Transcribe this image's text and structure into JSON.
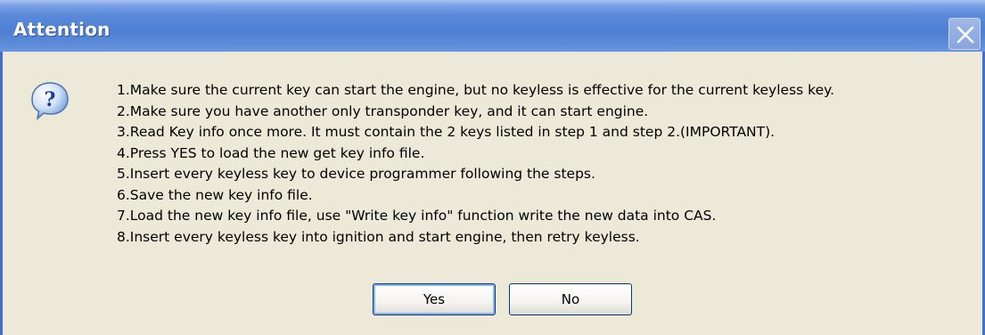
{
  "window": {
    "title": "Attention"
  },
  "icons": {
    "message_icon": "question-icon",
    "close_icon": "close-icon"
  },
  "message": {
    "lines": [
      "1.Make sure the current key can start the engine, but no keyless is effective for the current keyless key.",
      "2.Make sure you have another only transponder key, and it can start engine.",
      "3.Read Key info once more. It must contain the 2 keys listed in step 1 and step 2.(IMPORTANT).",
      "4.Press YES to load the new get key info file.",
      "5.Insert every keyless key to device programmer following the steps.",
      "6.Save the new key info file.",
      "7.Load the new key info file, use \"Write key info\" function write the new data into CAS.",
      "8.Insert every keyless key into ignition and start engine, then retry keyless."
    ]
  },
  "buttons": {
    "yes_label": "Yes",
    "no_label": "No"
  },
  "colors": {
    "titlebar": "#4d7fd3",
    "dialog_background": "#ece9d8",
    "border": "#3f6fcf"
  }
}
